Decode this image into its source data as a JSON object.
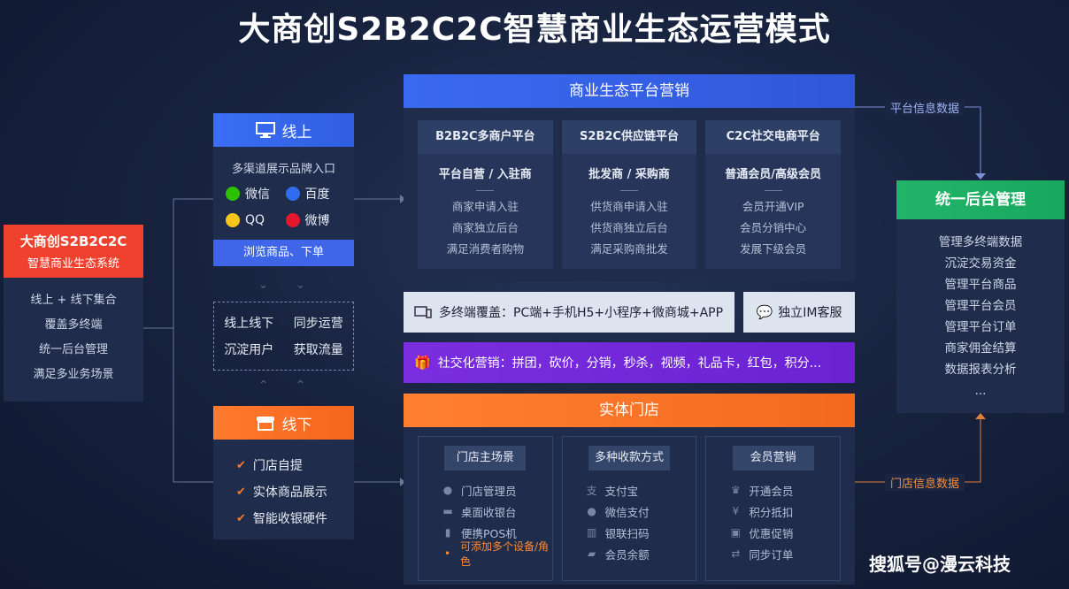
{
  "title": "大商创S2B2C2C智慧商业生态运营模式",
  "system": {
    "name": "大商创S2B2C2C",
    "subtitle": "智慧商业生态系统",
    "items": [
      "线上 + 线下集合",
      "覆盖多终端",
      "统一后台管理",
      "满足多业务场景"
    ]
  },
  "online": {
    "title": "线上",
    "subtitle": "多渠道展示品牌入口",
    "channels": [
      {
        "label": "微信",
        "icon": "wechat-icon",
        "color": "#2dc100"
      },
      {
        "label": "百度",
        "icon": "baidu-icon",
        "color": "#2f6cf0"
      },
      {
        "label": "QQ",
        "icon": "qq-icon",
        "color": "#f5c518"
      },
      {
        "label": "微博",
        "icon": "weibo-icon",
        "color": "#e6162d"
      }
    ],
    "footer": "浏览商品、下单"
  },
  "sync": {
    "items": [
      "线上线下",
      "同步运营",
      "沉淀用户",
      "获取流量"
    ]
  },
  "offline": {
    "title": "线下",
    "items": [
      "门店自提",
      "实体商品展示",
      "智能收银硬件"
    ]
  },
  "platform": {
    "title": "商业生态平台营销",
    "columns": [
      {
        "header": "B2B2C多商户平台",
        "sub": "平台自营 / 入驻商",
        "items": [
          "商家申请入驻",
          "商家独立后台",
          "满足消费者购物"
        ]
      },
      {
        "header": "S2B2C供应链平台",
        "sub": "批发商 / 采购商",
        "items": [
          "供货商申请入驻",
          "供货商独立后台",
          "满足采购商批发"
        ]
      },
      {
        "header": "C2C社交电商平台",
        "sub": "普通会员/高级会员",
        "items": [
          "会员开通VIP",
          "会员分销中心",
          "发展下级会员"
        ]
      }
    ]
  },
  "terminals": "多终端覆盖：PC端+手机H5+小程序+微商城+APP",
  "im": "独立IM客服",
  "social": "社交化营销：拼团，砍价，分销，秒杀，视频，礼品卡，红包，积分...",
  "store": {
    "title": "实体门店",
    "columns": [
      {
        "header": "门店主场景",
        "items": [
          "门店管理员",
          "桌面收银台",
          "便携POS机"
        ],
        "note": "可添加多个设备/角色"
      },
      {
        "header": "多种收款方式",
        "items": [
          "支付宝",
          "微信支付",
          "银联扫码",
          "会员余额"
        ]
      },
      {
        "header": "会员营销",
        "items": [
          "开通会员",
          "积分抵扣",
          "优惠促销",
          "同步订单"
        ]
      }
    ]
  },
  "backend": {
    "title": "统一后台管理",
    "items": [
      "管理多终端数据",
      "沉淀交易资金",
      "管理平台商品",
      "管理平台会员",
      "管理平台订单",
      "商家佣金结算",
      "数据报表分析",
      "..."
    ]
  },
  "labels": {
    "platform_data": "平台信息数据",
    "store_data": "门店信息数据"
  },
  "watermark": "搜狐号@漫云科技"
}
